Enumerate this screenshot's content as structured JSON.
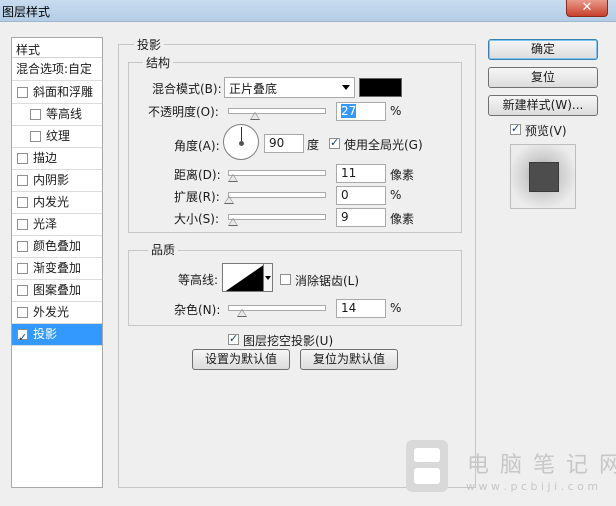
{
  "window": {
    "title": "图层样式",
    "close_glyph": "✕"
  },
  "left_list": {
    "header": "样式",
    "items": [
      {
        "label": "混合选项:自定",
        "has_checkbox": false,
        "checked": false,
        "indent": false,
        "selected": false
      },
      {
        "label": "斜面和浮雕",
        "has_checkbox": true,
        "checked": false,
        "indent": false,
        "selected": false
      },
      {
        "label": "等高线",
        "has_checkbox": true,
        "checked": false,
        "indent": true,
        "selected": false
      },
      {
        "label": "纹理",
        "has_checkbox": true,
        "checked": false,
        "indent": true,
        "selected": false
      },
      {
        "label": "描边",
        "has_checkbox": true,
        "checked": false,
        "indent": false,
        "selected": false
      },
      {
        "label": "内阴影",
        "has_checkbox": true,
        "checked": false,
        "indent": false,
        "selected": false
      },
      {
        "label": "内发光",
        "has_checkbox": true,
        "checked": false,
        "indent": false,
        "selected": false
      },
      {
        "label": "光泽",
        "has_checkbox": true,
        "checked": false,
        "indent": false,
        "selected": false
      },
      {
        "label": "颜色叠加",
        "has_checkbox": true,
        "checked": false,
        "indent": false,
        "selected": false
      },
      {
        "label": "渐变叠加",
        "has_checkbox": true,
        "checked": false,
        "indent": false,
        "selected": false
      },
      {
        "label": "图案叠加",
        "has_checkbox": true,
        "checked": false,
        "indent": false,
        "selected": false
      },
      {
        "label": "外发光",
        "has_checkbox": true,
        "checked": false,
        "indent": false,
        "selected": false
      },
      {
        "label": "投影",
        "has_checkbox": true,
        "checked": true,
        "indent": false,
        "selected": true
      }
    ]
  },
  "drop_shadow": {
    "group_title": "投影",
    "structure": {
      "title": "结构",
      "blend_mode_label": "混合模式(B):",
      "blend_mode_value": "正片叠底",
      "shadow_color": "#000000",
      "opacity_label": "不透明度(O):",
      "opacity_value": "27",
      "opacity_slider": 0.27,
      "opacity_unit": "%",
      "angle_label": "角度(A):",
      "angle_value": "90",
      "angle_unit": "度",
      "global_light_label": "使用全局光(G)",
      "global_light_checked": true,
      "distance_label": "距离(D):",
      "distance_value": "11",
      "distance_slider": 0.04,
      "distance_unit": "像素",
      "spread_label": "扩展(R):",
      "spread_value": "0",
      "spread_slider": 0,
      "spread_unit": "%",
      "size_label": "大小(S):",
      "size_value": "9",
      "size_slider": 0.04,
      "size_unit": "像素"
    },
    "quality": {
      "title": "品质",
      "contour_label": "等高线:",
      "anti_alias_label": "消除锯齿(L)",
      "anti_alias_checked": false,
      "noise_label": "杂色(N):",
      "noise_value": "14",
      "noise_slider": 0.14,
      "noise_unit": "%"
    },
    "knockout_label": "图层挖空投影(U)",
    "knockout_checked": true,
    "make_default_label": "设置为默认值",
    "reset_default_label": "复位为默认值"
  },
  "right_buttons": {
    "ok": "确定",
    "reset": "复位",
    "new_style": "新建样式(W)...",
    "preview_label": "预览(V)",
    "preview_checked": true
  },
  "watermark": {
    "line1": "电 脑 笔 记 网",
    "line2": "w w w . p c b i j i . c o m"
  }
}
